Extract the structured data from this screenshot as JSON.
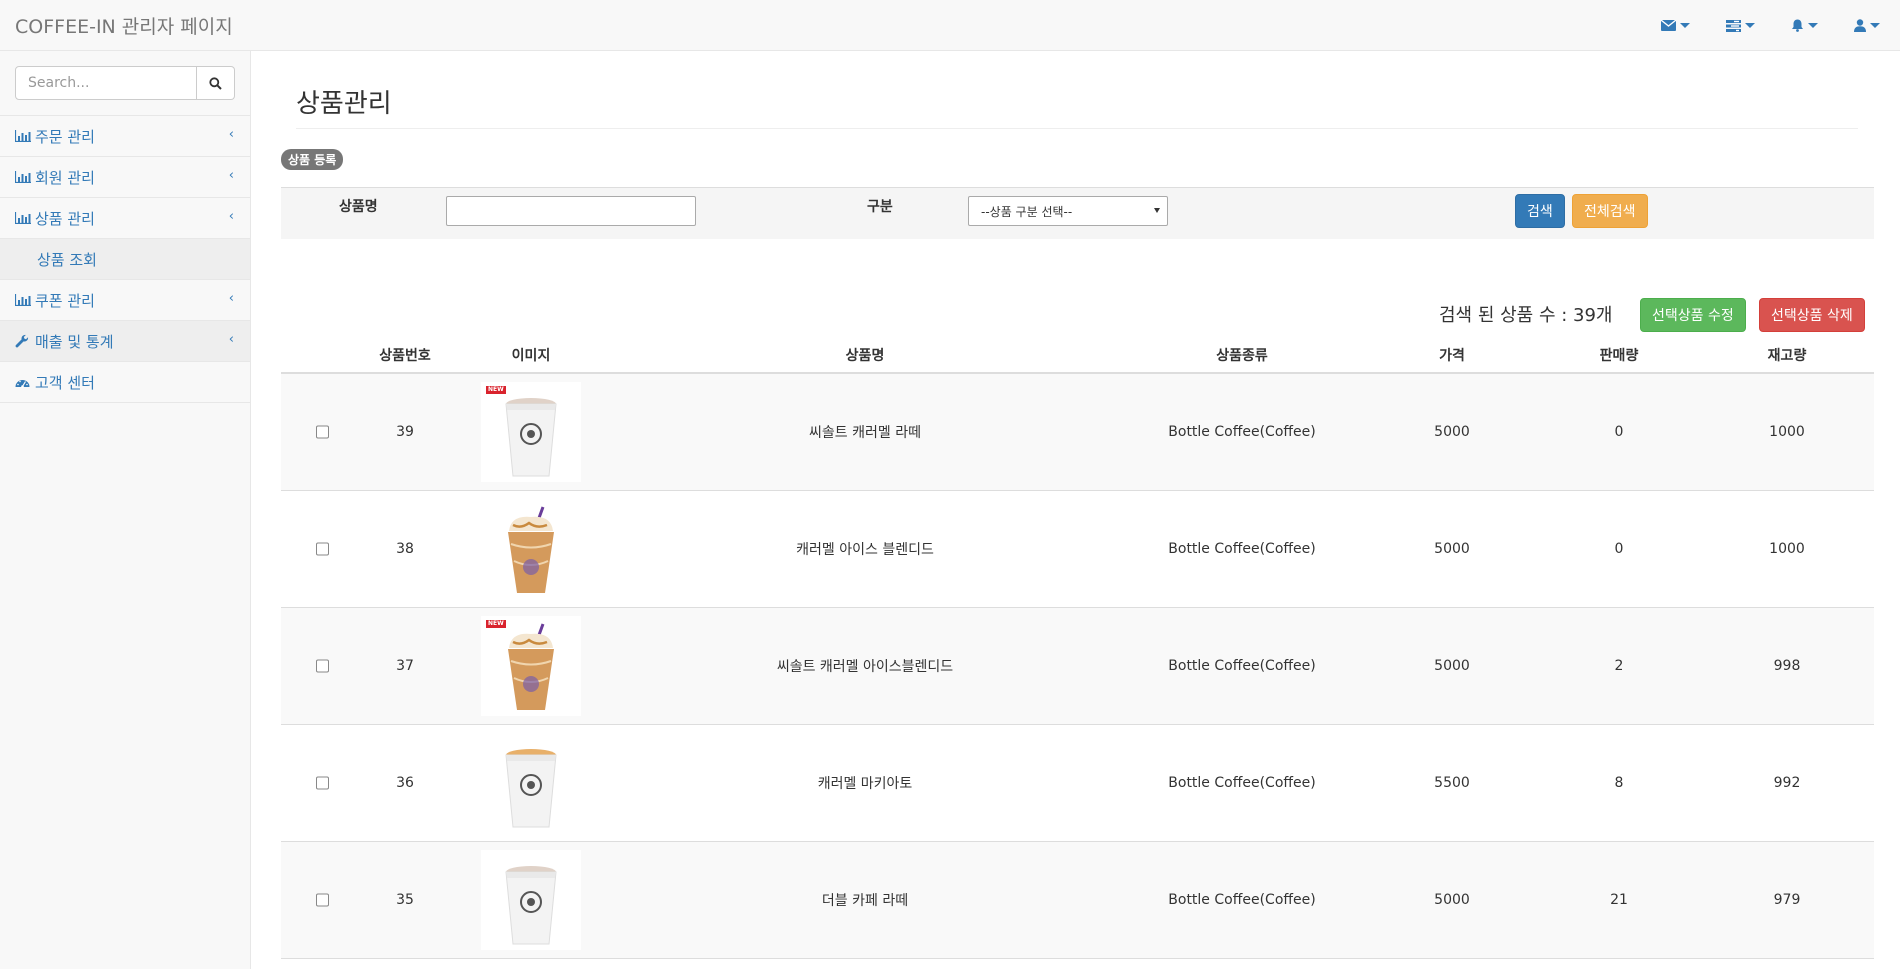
{
  "navbar": {
    "brand": "COFFEE-IN 관리자 페이지",
    "icons": [
      "envelope-icon",
      "tasks-icon",
      "bell-icon",
      "user-icon"
    ]
  },
  "sidebar": {
    "search_placeholder": "Search...",
    "items": [
      {
        "label": "주문 관리",
        "icon": "bar-chart-icon"
      },
      {
        "label": "회원 관리",
        "icon": "bar-chart-icon"
      },
      {
        "label": "상품 관리",
        "icon": "bar-chart-icon"
      },
      {
        "label": "상품 조회"
      },
      {
        "label": "쿠폰 관리",
        "icon": "bar-chart-icon"
      },
      {
        "label": "매출 및 통계",
        "icon": "wrench-icon"
      },
      {
        "label": "고객 센터",
        "icon": "dashboard-icon"
      }
    ]
  },
  "page": {
    "title": "상품관리",
    "register_badge": "상품 등록"
  },
  "search": {
    "name_label": "상품명",
    "name_value": "",
    "type_label": "구분",
    "type_selected": "--상품 구분 선택--",
    "search_button": "검색",
    "search_all_button": "전체검색"
  },
  "results": {
    "count_text": "검색 된 상품 수 : 39개",
    "edit_button": "선택상품 수정",
    "delete_button": "선택상품 삭제"
  },
  "table": {
    "headers": [
      "상품번호",
      "이미지",
      "상품명",
      "상품종류",
      "가격",
      "판매량",
      "재고량"
    ],
    "rows": [
      {
        "id": "39",
        "name": "씨솔트 캐러멜 라떼",
        "type": "Bottle Coffee(Coffee)",
        "price": "5000",
        "sold": "0",
        "stock": "1000",
        "new": true,
        "style": "latte"
      },
      {
        "id": "38",
        "name": "캐러멜 아이스 블렌디드",
        "type": "Bottle Coffee(Coffee)",
        "price": "5000",
        "sold": "0",
        "stock": "1000",
        "new": false,
        "style": "blended"
      },
      {
        "id": "37",
        "name": "씨솔트 캐러멜 아이스블렌디드",
        "type": "Bottle Coffee(Coffee)",
        "price": "5000",
        "sold": "2",
        "stock": "998",
        "new": true,
        "style": "blended"
      },
      {
        "id": "36",
        "name": "캐러멜 마키아토",
        "type": "Bottle Coffee(Coffee)",
        "price": "5500",
        "sold": "8",
        "stock": "992",
        "new": false,
        "style": "macchiato"
      },
      {
        "id": "35",
        "name": "더블 카페 라떼",
        "type": "Bottle Coffee(Coffee)",
        "price": "5000",
        "sold": "21",
        "stock": "979",
        "new": false,
        "style": "latte"
      }
    ],
    "new_badge_text": "NEW"
  }
}
